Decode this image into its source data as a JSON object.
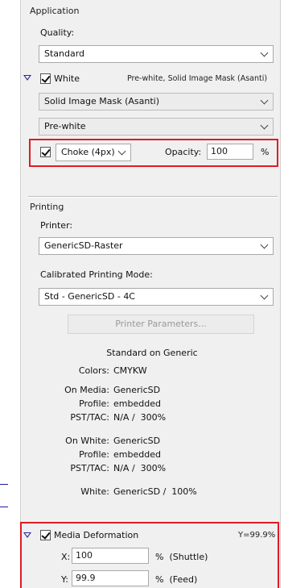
{
  "application": {
    "header": "Application",
    "quality_label": "Quality:",
    "quality_value": "Standard",
    "white_label": "White",
    "white_summary": "Pre-white, Solid Image Mask (Asanti)",
    "mask_value": "Solid Image Mask (Asanti)",
    "prewhite_value": "Pre-white",
    "choke_value": "Choke (4px)",
    "opacity_label": "Opacity:",
    "opacity_value": "100",
    "opacity_unit": "%"
  },
  "printing": {
    "header": "Printing",
    "printer_label": "Printer:",
    "printer_value": "GenericSD-Raster",
    "mode_label": "Calibrated Printing Mode:",
    "mode_value": "Std - GenericSD - 4C",
    "params_button": "Printer Parameters...",
    "summary_title": "Standard on Generic",
    "colors_key": "Colors:",
    "colors_val": "CMYKW",
    "on_media_key": "On Media:",
    "on_media_val": "GenericSD",
    "profile1_key": "Profile:",
    "profile1_val": "embedded",
    "psttac1_key": "PST/TAC:",
    "psttac1_val": "N/A /  300%",
    "on_white_key": "On White:",
    "on_white_val": "GenericSD",
    "profile2_key": "Profile:",
    "profile2_val": "embedded",
    "psttac2_key": "PST/TAC:",
    "psttac2_val": "N/A /  300%",
    "white_key": "White:",
    "white_val": "GenericSD /  100%"
  },
  "deformation": {
    "label": "Media Deformation",
    "summary": "Y=99.9%",
    "x_label": "X:",
    "x_value": "100",
    "x_unit": "%  (Shuttle)",
    "y_label": "Y:",
    "y_value": "99.9",
    "y_unit": "%  (Feed)"
  },
  "colors": {
    "highlight": "#e01b24",
    "disclosure": "#2a2a9a"
  }
}
